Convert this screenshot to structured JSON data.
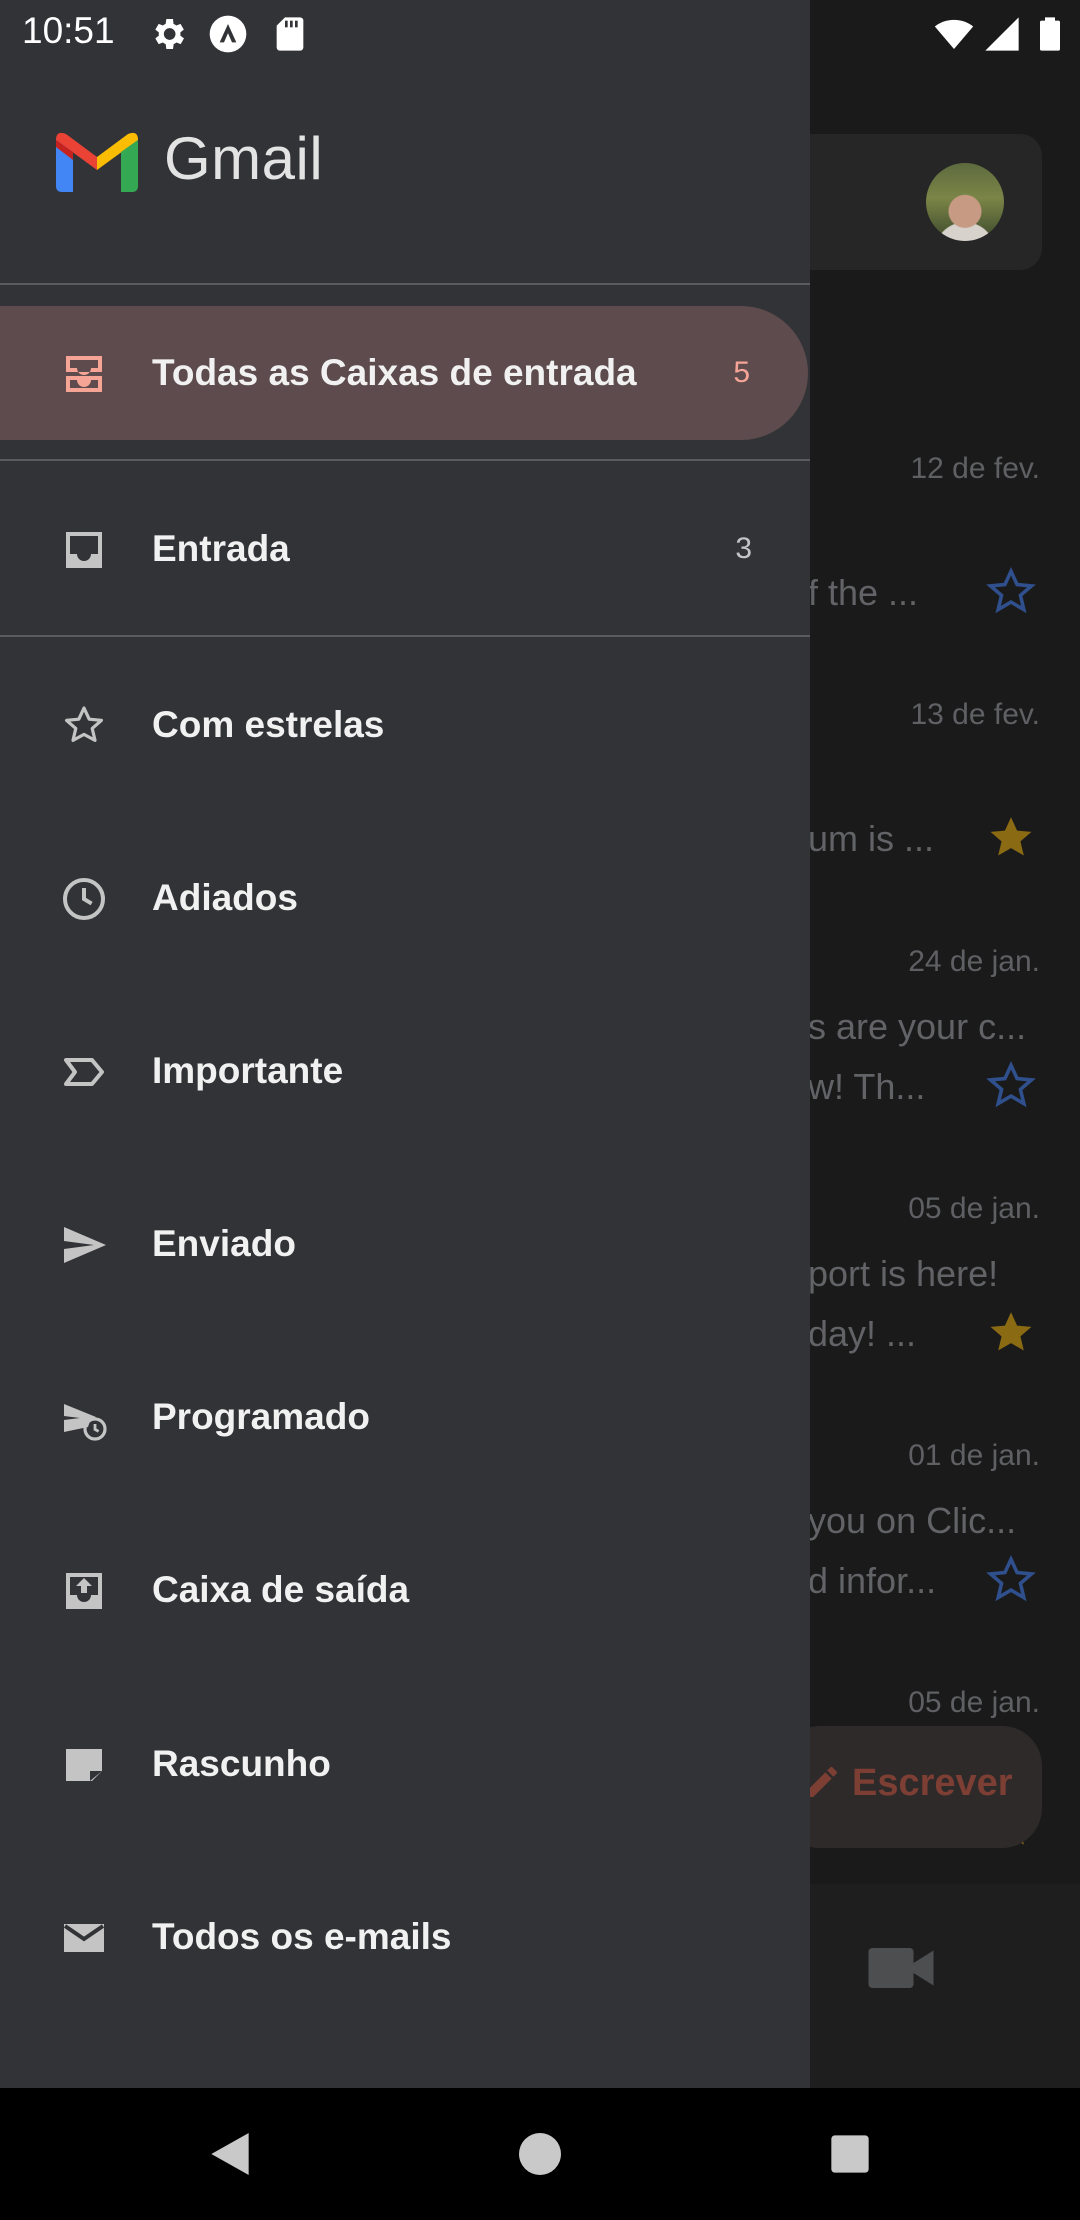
{
  "status_bar": {
    "time": "10:51",
    "left_icons": [
      "settings-icon",
      "app-alert-icon",
      "sd-card-icon"
    ],
    "right_icons": [
      "wifi-icon",
      "cell-signal-icon",
      "battery-icon"
    ]
  },
  "drawer": {
    "app_name": "Gmail",
    "items": [
      {
        "label": "Todas as Caixas de entrada",
        "count": "5",
        "icon": "all-inboxes-icon",
        "active": true
      },
      {
        "label": "Entrada",
        "count": "3",
        "icon": "inbox-icon"
      },
      {
        "label": "Com estrelas",
        "icon": "star-outline-icon"
      },
      {
        "label": "Adiados",
        "icon": "clock-icon"
      },
      {
        "label": "Importante",
        "icon": "label-important-icon"
      },
      {
        "label": "Enviado",
        "icon": "send-icon"
      },
      {
        "label": "Programado",
        "icon": "schedule-send-icon"
      },
      {
        "label": "Caixa de saída",
        "icon": "outbox-icon"
      },
      {
        "label": "Rascunho",
        "icon": "draft-icon"
      },
      {
        "label": "Todos os e-mails",
        "icon": "mail-icon"
      }
    ]
  },
  "background_list": {
    "emails": [
      {
        "date": "12 de fev.",
        "lines": [
          "f the ..."
        ],
        "starred": false
      },
      {
        "date": "13 de fev.",
        "lines": [
          "um is ..."
        ],
        "starred": true
      },
      {
        "date": "24 de jan.",
        "lines": [
          "s are your c...",
          "w! Th..."
        ],
        "starred": false
      },
      {
        "date": "05 de jan.",
        "lines": [
          "port is here!",
          "day! ..."
        ],
        "starred": true
      },
      {
        "date": "01 de jan.",
        "lines": [
          "you on Clic...",
          "d infor..."
        ],
        "starred": false
      },
      {
        "date": "05 de jan.",
        "lines": [],
        "starred": true
      }
    ],
    "compose_label": "Escrever"
  },
  "colors": {
    "drawer_bg": "#323337",
    "active_item_bg": "#5d4b4d",
    "active_accent": "#f5a495",
    "star_filled": "#8a6a12",
    "star_outline": "#2f4f8d"
  }
}
